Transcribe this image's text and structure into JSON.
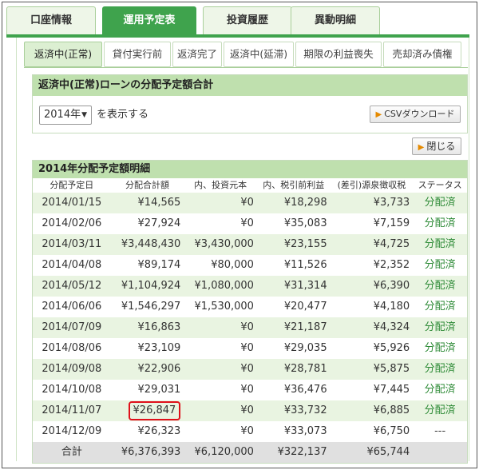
{
  "top_tabs": [
    {
      "label": "口座情報",
      "active": false
    },
    {
      "label": "運用予定表",
      "active": true
    },
    {
      "label": "投資履歴",
      "active": false
    },
    {
      "label": "異動明細",
      "active": false
    }
  ],
  "sub_tabs": [
    {
      "label": "返済中(正常)",
      "active": true
    },
    {
      "label": "貸付実行前",
      "active": false
    },
    {
      "label": "返済完了",
      "active": false
    },
    {
      "label": "返済中(延滞)",
      "active": false
    },
    {
      "label": "期限の利益喪失",
      "active": false
    },
    {
      "label": "売却済み債権",
      "active": false
    }
  ],
  "summary_box": {
    "title": "返済中(正常)ローンの分配予定額合計",
    "year_select": {
      "value": "2014年",
      "caret": "▼"
    },
    "select_suffix": "を表示する",
    "csv_button": "CSVダウンロード"
  },
  "close_button": "閉じる",
  "detail": {
    "title": "2014年分配予定額明細",
    "columns": [
      "分配予定日",
      "分配合計額",
      "内、投資元本",
      "内、税引前利益",
      "(差引)源泉徴収税",
      "ステータス"
    ],
    "rows": [
      {
        "date": "2014/01/15",
        "total": "¥14,565",
        "principal": "¥0",
        "profit": "¥18,298",
        "tax": "¥3,733",
        "status": "分配済"
      },
      {
        "date": "2014/02/06",
        "total": "¥27,924",
        "principal": "¥0",
        "profit": "¥35,083",
        "tax": "¥7,159",
        "status": "分配済"
      },
      {
        "date": "2014/03/11",
        "total": "¥3,448,430",
        "principal": "¥3,430,000",
        "profit": "¥23,155",
        "tax": "¥4,725",
        "status": "分配済"
      },
      {
        "date": "2014/04/08",
        "total": "¥89,174",
        "principal": "¥80,000",
        "profit": "¥11,526",
        "tax": "¥2,352",
        "status": "分配済"
      },
      {
        "date": "2014/05/12",
        "total": "¥1,104,924",
        "principal": "¥1,080,000",
        "profit": "¥31,314",
        "tax": "¥6,390",
        "status": "分配済"
      },
      {
        "date": "2014/06/06",
        "total": "¥1,546,297",
        "principal": "¥1,530,000",
        "profit": "¥20,477",
        "tax": "¥4,180",
        "status": "分配済"
      },
      {
        "date": "2014/07/09",
        "total": "¥16,863",
        "principal": "¥0",
        "profit": "¥21,187",
        "tax": "¥4,324",
        "status": "分配済"
      },
      {
        "date": "2014/08/06",
        "total": "¥23,109",
        "principal": "¥0",
        "profit": "¥29,035",
        "tax": "¥5,926",
        "status": "分配済"
      },
      {
        "date": "2014/09/08",
        "total": "¥22,906",
        "principal": "¥0",
        "profit": "¥28,781",
        "tax": "¥5,875",
        "status": "分配済"
      },
      {
        "date": "2014/10/08",
        "total": "¥29,031",
        "principal": "¥0",
        "profit": "¥36,476",
        "tax": "¥7,445",
        "status": "分配済"
      },
      {
        "date": "2014/11/07",
        "total": "¥26,847",
        "principal": "¥0",
        "profit": "¥33,732",
        "tax": "¥6,885",
        "status": "分配済",
        "highlighted": true
      },
      {
        "date": "2014/12/09",
        "total": "¥26,323",
        "principal": "¥0",
        "profit": "¥33,073",
        "tax": "¥6,750",
        "status": "---"
      }
    ],
    "total_row": {
      "label": "合計",
      "total": "¥6,376,393",
      "principal": "¥6,120,000",
      "profit": "¥322,137",
      "tax": "¥65,744",
      "status": ""
    }
  },
  "colors": {
    "accent": "#3fa34d",
    "header_band": "#bfe0ae",
    "row_alt": "#e9f4e1",
    "highlight": "#e0101a"
  }
}
